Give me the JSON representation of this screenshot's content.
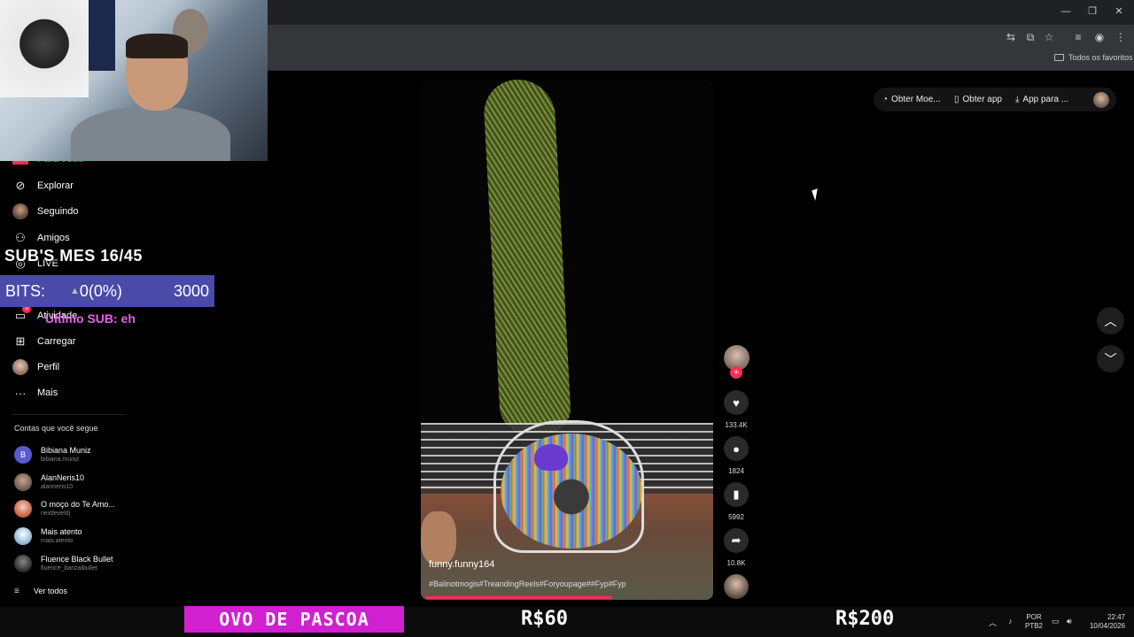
{
  "browser": {
    "bookmarks_folder": "Todos os favoritos"
  },
  "sidebar": {
    "partial_item": "Para você",
    "items": [
      {
        "label": "Explorar",
        "icon": "compass-icon"
      },
      {
        "label": "Seguindo",
        "icon": "following-avatar"
      },
      {
        "label": "Amigos",
        "icon": "friends-icon"
      },
      {
        "label": "LIVE",
        "icon": "live-icon"
      },
      {
        "label": "Atividade",
        "icon": "activity-icon",
        "badge": "3"
      },
      {
        "label": "Carregar",
        "icon": "upload-icon"
      },
      {
        "label": "Perfil",
        "icon": "profile-avatar"
      },
      {
        "label": "Mais",
        "icon": "more-icon"
      }
    ],
    "following_title": "Contas que você segue",
    "accounts": [
      {
        "name": "Bibiana Muniz",
        "handle": "bibiana.muniz",
        "initial": "B",
        "color": "#5a5ad0"
      },
      {
        "name": "AlanNeris10",
        "handle": "alanneris10",
        "initial": "",
        "color": "#6a5a50"
      },
      {
        "name": "O moço do Te Amo...",
        "handle": "nextleveldj",
        "initial": "",
        "color": "#c85a3a"
      },
      {
        "name": "Mais atento",
        "handle": "mais.atento",
        "initial": "",
        "color": "#8ab0d0"
      },
      {
        "name": "Fluence Black Bullet",
        "handle": "fluence_banzaibullet",
        "initial": "",
        "color": "#3a3a3a"
      }
    ],
    "see_all": "Ver todos"
  },
  "overlay": {
    "subs": "SUB'S MES 16/45",
    "bits_label": "BITS:",
    "bits_value": "0(0%)",
    "bits_goal": "3000",
    "last_sub": "Ultimo SUB: eh",
    "ovo": "OVO DE PASCOA",
    "price1": "R$60",
    "price2": "R$200"
  },
  "header": {
    "coins": "Obter Moe...",
    "get_app": "Obter app",
    "app_for": "App para ..."
  },
  "video": {
    "username": "funny.funny164",
    "tags": "#Balinotmogis#TreandingReels#Foryoupage##Fyp#Fyp",
    "progress": 0.66,
    "likes": "133.4K",
    "comments": "1824",
    "saves": "5992",
    "shares": "10.8K"
  },
  "taskbar": {
    "lang_top": "POR",
    "lang_bottom": "PTB2",
    "time": "22:47",
    "date": "10/04/2026"
  }
}
